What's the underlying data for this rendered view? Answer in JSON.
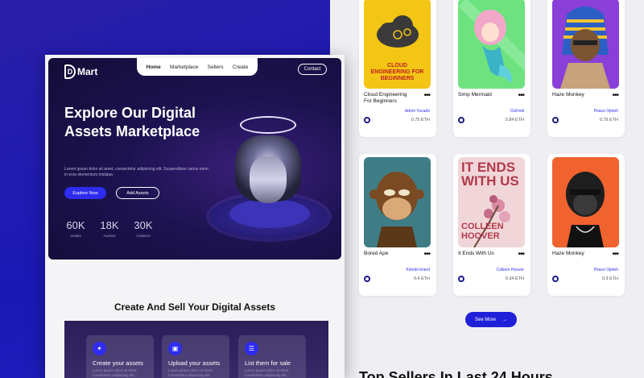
{
  "site": {
    "logo": "Mart",
    "logo_mark": "D",
    "nav": [
      "Home",
      "Marketplace",
      "Sellers",
      "Create"
    ],
    "contact": "Contact"
  },
  "hero": {
    "title": "Explore Our Digital Assets Marketplace",
    "subtitle": "Lorem ipsum dolor sit amet, consectetur adipiscing elit. Suspendisse varius enim in eros elementum tristique.",
    "explore_btn": "Explore Now",
    "add_btn": "Add Assets",
    "stats": [
      {
        "value": "60K",
        "label": "Assets"
      },
      {
        "value": "18K",
        "label": "Auction"
      },
      {
        "value": "30K",
        "label": "Creators"
      }
    ]
  },
  "create_section": {
    "title": "Create And Sell Your Digital Assets",
    "steps": [
      {
        "title": "Create your assets",
        "text": "Lorem ipsum dolor sit amet, consectetur adipiscing elit.",
        "icon": "create-icon"
      },
      {
        "title": "Upload your assets",
        "text": "Lorem ipsum dolor sit amet, consectetur adipiscing elit.",
        "icon": "image-icon"
      },
      {
        "title": "List them for sale",
        "text": "Lorem ipsum dolor sit amet, consectetur adipiscing elit.",
        "icon": "list-icon"
      }
    ]
  },
  "nfts": [
    {
      "name": "Cloud Engineering For Beginners",
      "creator": "Adom Yuvado",
      "price": "0.75 ETH",
      "cover_title": "CLOUD ENGINEERING FOR BEGINNERS"
    },
    {
      "name": "Simp Mermaid",
      "creator": "CloFedi",
      "price": "0.84 ETH"
    },
    {
      "name": "Haze Monkey",
      "creator": "Peace Ojeteh",
      "price": "0.79 ETH"
    },
    {
      "name": "Bored Ape",
      "creator": "Kimobi brand",
      "price": "0.4 ETH"
    },
    {
      "name": "It Ends With Us",
      "creator": "Colleen Hoover",
      "price": "0.34 ETH",
      "cover_title": "IT ENDS WITH US",
      "cover_author": "COLLEEN HOOVER"
    },
    {
      "name": "Haze Monkey",
      "creator": "Peace Ojeteh",
      "price": "0.3 ETH"
    }
  ],
  "see_more": "See More",
  "top_sellers": "Top Sellers In Last 24 Hours",
  "colors": {
    "primary": "#2d2cf0",
    "background_blue": "#1a18b5",
    "hero_dark": "#140d38"
  }
}
